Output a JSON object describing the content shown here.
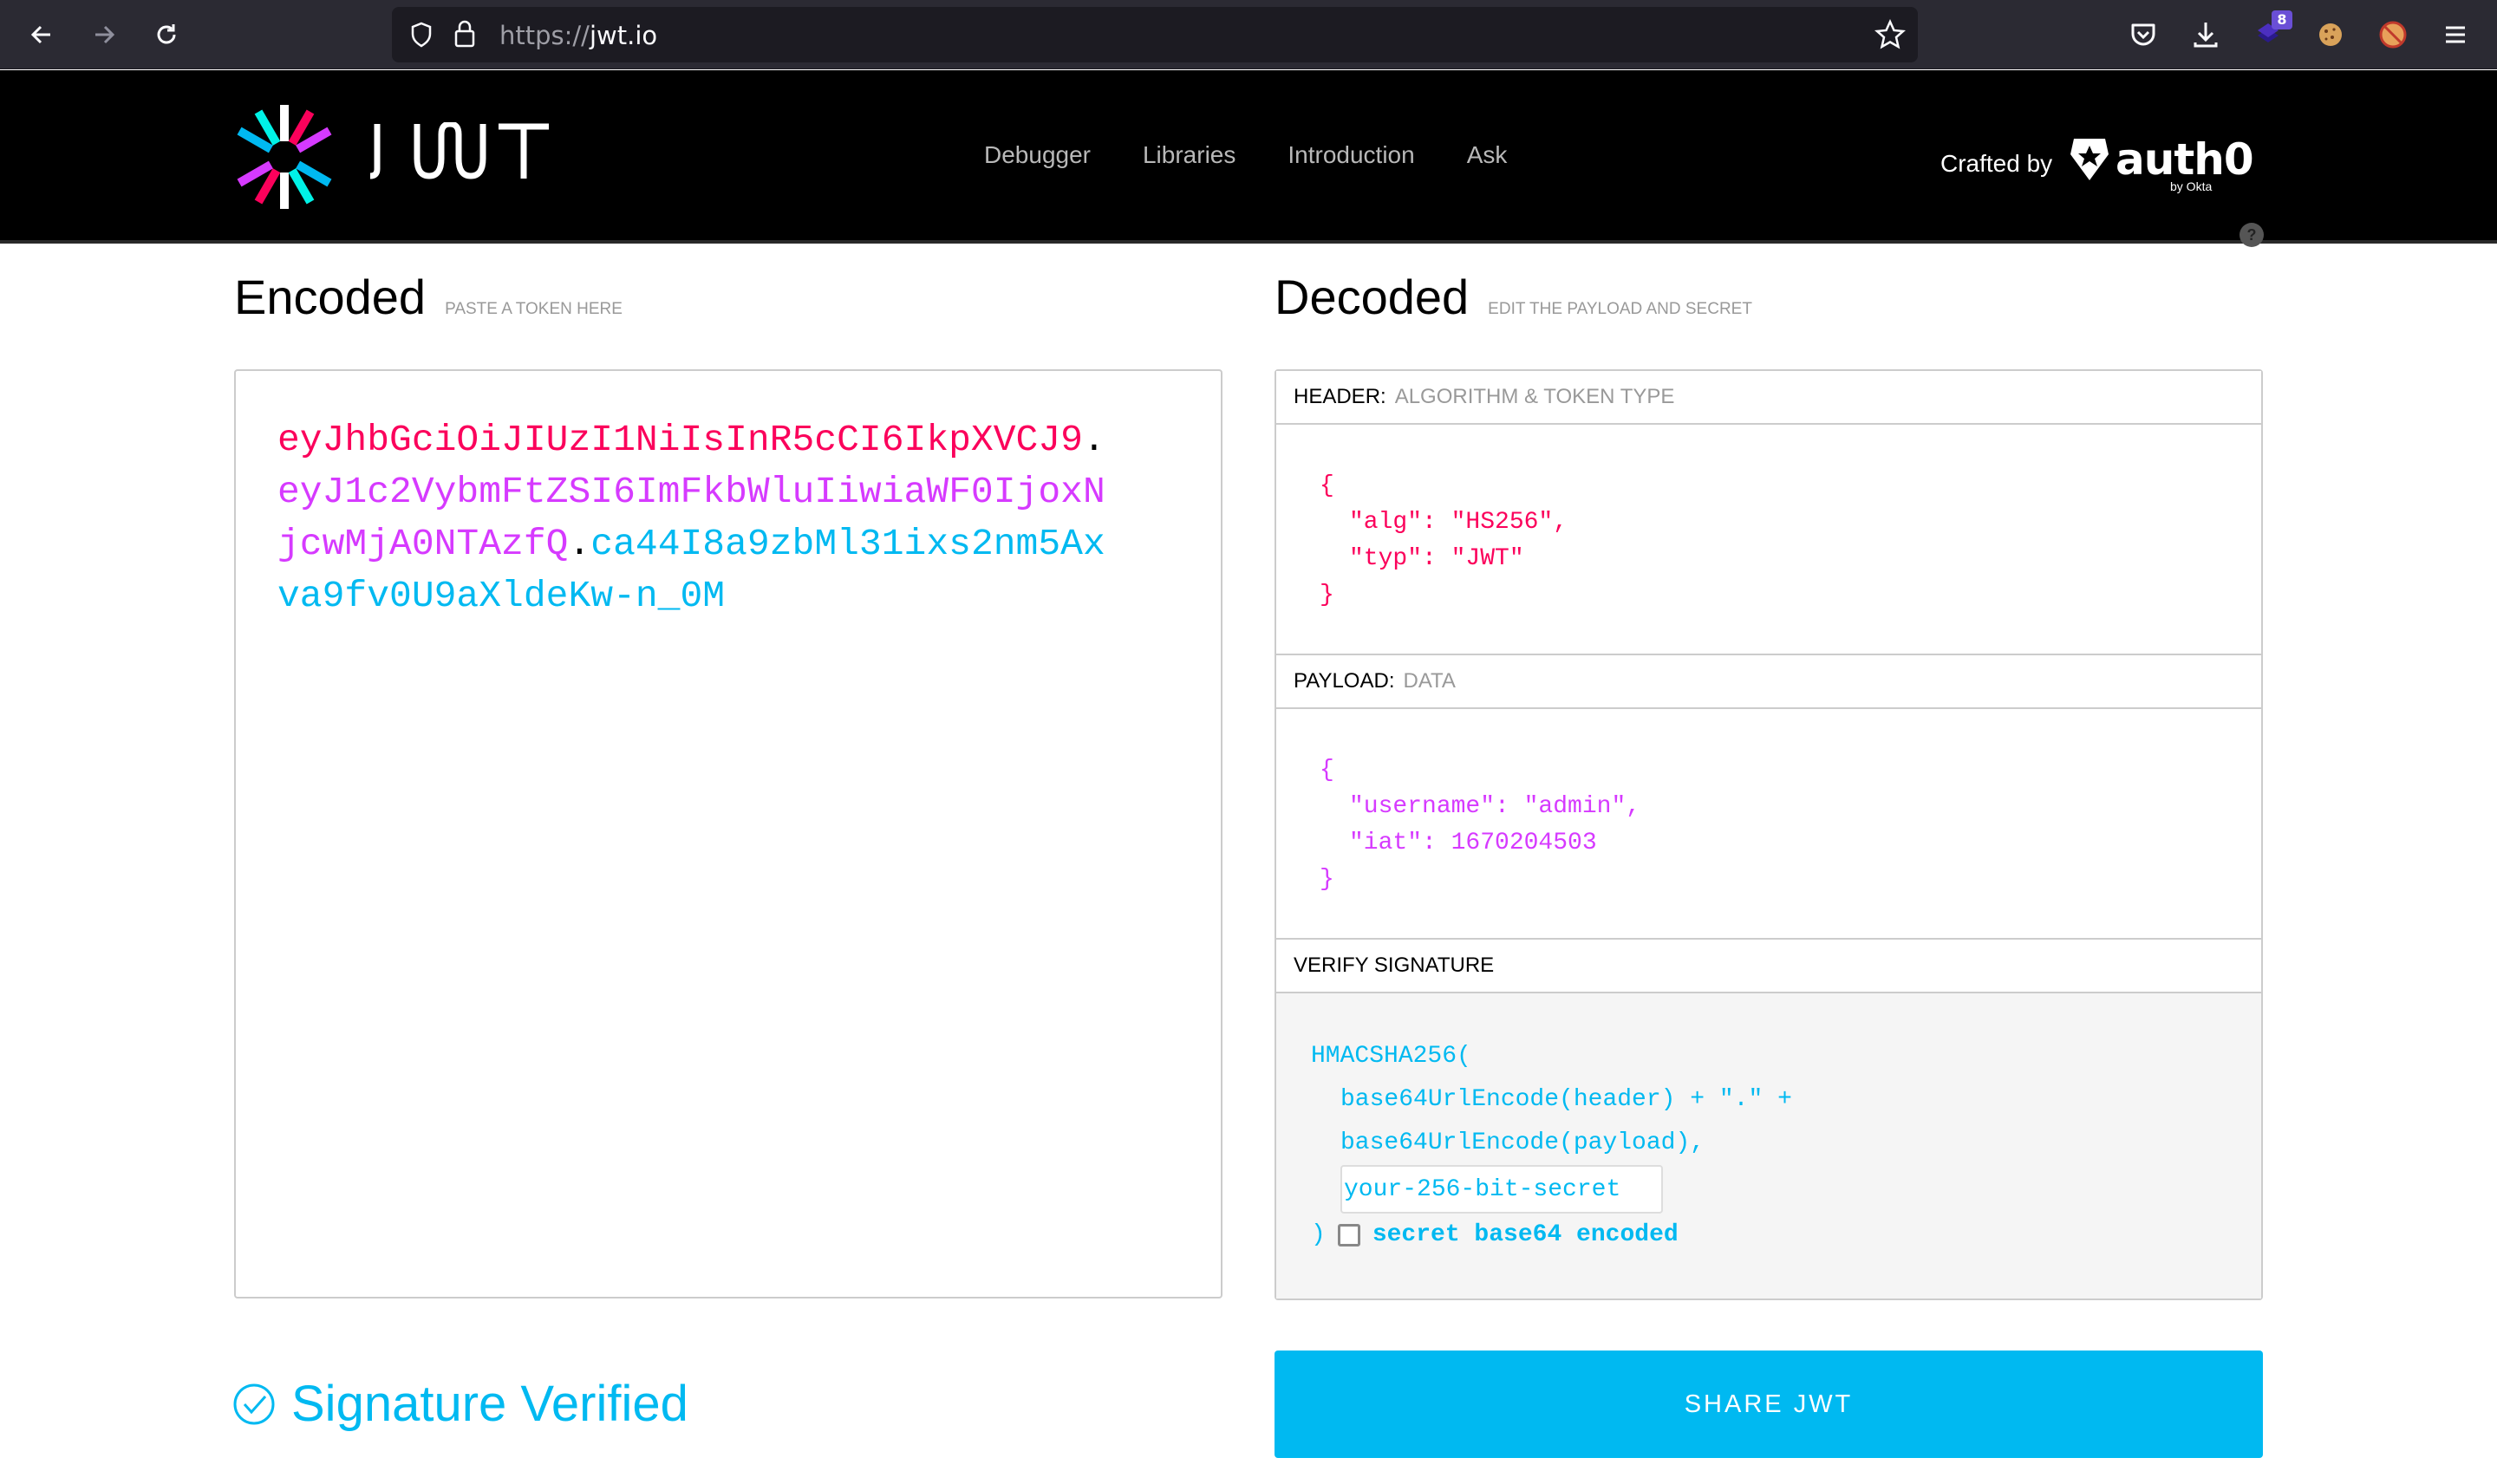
{
  "browser": {
    "url_scheme": "https://",
    "url_host": "jwt.io",
    "extension_badge": "8"
  },
  "header": {
    "logo_text": "JWT",
    "nav": [
      {
        "label": "Debugger"
      },
      {
        "label": "Libraries"
      },
      {
        "label": "Introduction"
      },
      {
        "label": "Ask"
      }
    ],
    "crafted_by": "Crafted by",
    "brand": "auth0",
    "brand_sub": "by Okta",
    "help": "?"
  },
  "encoded": {
    "title": "Encoded",
    "subtitle": "PASTE A TOKEN HERE",
    "token_header": "eyJhbGciOiJIUzI1NiIsInR5cCI6IkpXVCJ9",
    "token_payload": "eyJ1c2VybmFtZSI6ImFkbWluIiwiaWF0IjoxNjcwMjA0NTAzfQ",
    "token_signature": "ca44I8a9zbMl31ixs2nm5Axva9fv0U9aXldeKw-n_0M",
    "dot": "."
  },
  "decoded": {
    "title": "Decoded",
    "subtitle": "EDIT THE PAYLOAD AND SECRET",
    "header_section": {
      "label": "HEADER:",
      "sublabel": "ALGORITHM & TOKEN TYPE",
      "open": "{",
      "lines": [
        "\"alg\": \"HS256\",",
        "\"typ\": \"JWT\""
      ],
      "close": "}"
    },
    "payload_section": {
      "label": "PAYLOAD:",
      "sublabel": "DATA",
      "open": "{",
      "lines": [
        "\"username\": \"admin\",",
        "\"iat\": 1670204503"
      ],
      "close": "}"
    },
    "signature_section": {
      "label": "VERIFY SIGNATURE",
      "fn": "HMACSHA256(",
      "line1": "base64UrlEncode(header) + \".\" +",
      "line2": "base64UrlEncode(payload),",
      "secret_value": "your-256-bit-secret",
      "close": ")",
      "checkbox_label": "secret base64 encoded",
      "checkbox_checked": false
    }
  },
  "footer": {
    "status": "Signature Verified",
    "share_button": "SHARE JWT"
  },
  "colors": {
    "header_red": "#fb015b",
    "payload_purple": "#d63aff",
    "signature_blue": "#00b9f1"
  }
}
